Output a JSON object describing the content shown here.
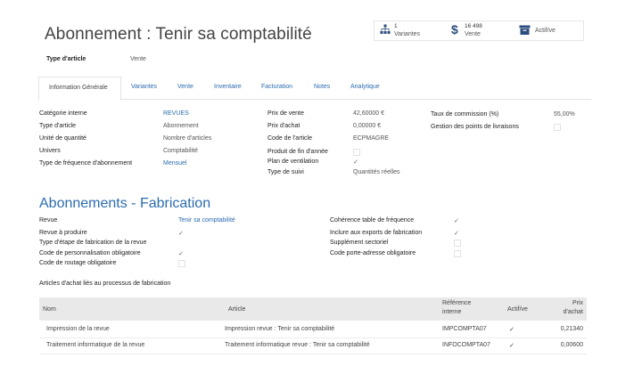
{
  "header": {
    "title": "Abonnement : Tenir sa comptabilité",
    "type_label": "Type d'article",
    "type_value": "Vente"
  },
  "smart_buttons": {
    "variants_count": "1",
    "variants_label": "Variantes",
    "sales_count": "16 498",
    "sales_label": "Vente",
    "active_label": "Actif/ve"
  },
  "tabs": [
    "Information Générale",
    "Variantes",
    "Vente",
    "Inventaire",
    "Facturation",
    "Notes",
    "Analytique"
  ],
  "general": {
    "col1": [
      {
        "label": "Catégorie interne",
        "value": "REVUES"
      },
      {
        "label": "Type d'article",
        "value": "Abonnement"
      },
      {
        "label": "Unité de quantité",
        "value": "Nombre d'articles"
      },
      {
        "label": "Univers",
        "value": "Comptabilité"
      },
      {
        "label": "Type de fréquence d'abonnement",
        "value": "Mensuel"
      }
    ],
    "col2": [
      {
        "label": "Prix de vente",
        "value": "42,60000 €"
      },
      {
        "label": "Prix d'achat",
        "value": "0,00000 €"
      },
      {
        "label": "Code de l'article",
        "value": "ECPMAGRE"
      },
      {
        "label": "Produit de fin d'année",
        "value": ""
      },
      {
        "label": "Plan de ventilation",
        "value": "✓"
      },
      {
        "label": "Type de suivi",
        "value": "Quantités réelles"
      }
    ],
    "col3": [
      {
        "label": "Taux de commission (%)",
        "value": "55,00%"
      },
      {
        "label": "Gestion des points de livraisons",
        "value": ""
      }
    ]
  },
  "section": {
    "title": "Abonnements - Fabrication",
    "left": [
      {
        "label": "Revue",
        "value": "Tenir sa comptabilité"
      },
      {
        "label": "Revue à produire",
        "value": "✓"
      },
      {
        "label": "Type d'étape de fabrication de la revue",
        "value": ""
      },
      {
        "label": "Code de personnalisation obligatoire",
        "value": "✓"
      },
      {
        "label": "Code de routage obligatoire",
        "value": ""
      }
    ],
    "right": [
      {
        "label": "Cohérence table de fréquence",
        "value": "✓"
      },
      {
        "label": "Inclure aux exports de fabrication",
        "value": "✓"
      },
      {
        "label": "Supplément sectoriel",
        "value": ""
      },
      {
        "label": "Code porte-adresse obligatoire",
        "value": ""
      }
    ],
    "linked_title": "Articles d'achat liés au processus de fabrication"
  },
  "table": {
    "headers": {
      "nom": "Nom",
      "article": "Article",
      "ref_line1": "Référence",
      "ref_line2": "interne",
      "actif": "Actif/ve",
      "prix_line1": "Prix",
      "prix_line2": "d'achat"
    },
    "rows": [
      {
        "nom": "Impression de la revue",
        "article": "Impression revue : Tenir sa comptabilité",
        "ref": "IMPCOMPTA07",
        "actif": "✓",
        "prix": "0,21340"
      },
      {
        "nom": "Traitement informatique de la revue",
        "article": "Traitement informatique revue : Tenir sa comptabilité",
        "ref": "INFOCOMPTA07",
        "actif": "✓",
        "prix": "0,00600"
      }
    ]
  },
  "colors": {
    "accent": "#2b6cb0",
    "table_header": "#e9e9e9"
  }
}
